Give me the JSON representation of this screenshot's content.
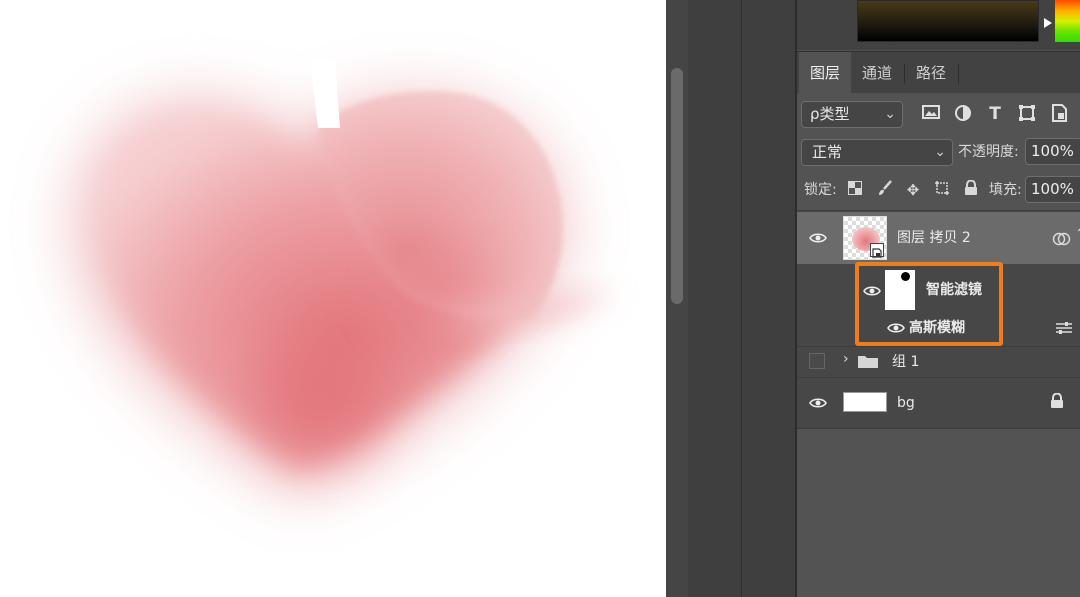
{
  "panel": {
    "tabs": [
      {
        "label": "图层",
        "active": true
      },
      {
        "label": "通道",
        "active": false
      },
      {
        "label": "路径",
        "active": false
      }
    ],
    "filter": {
      "label": "ρ类型"
    },
    "blend_mode": "正常",
    "opacity_label": "不透明度:",
    "opacity_value": "100%",
    "lock_label": "锁定:",
    "fill_label": "填充:",
    "fill_value": "100%"
  },
  "layers": [
    {
      "name": "图层 拷贝 2",
      "visible": true,
      "selected": true,
      "type": "smart-object"
    },
    {
      "name": "智能滤镜",
      "visible": true,
      "type": "smart-filter"
    },
    {
      "name": "高斯模糊",
      "visible": true,
      "type": "filter"
    },
    {
      "name": "组 1",
      "visible": false,
      "type": "group"
    },
    {
      "name": "bg",
      "visible": true,
      "locked": true,
      "type": "background"
    }
  ],
  "colors": {
    "accent_highlight": "#f07d1c",
    "panel_bg": "#535353",
    "heart": "#e37d82"
  }
}
